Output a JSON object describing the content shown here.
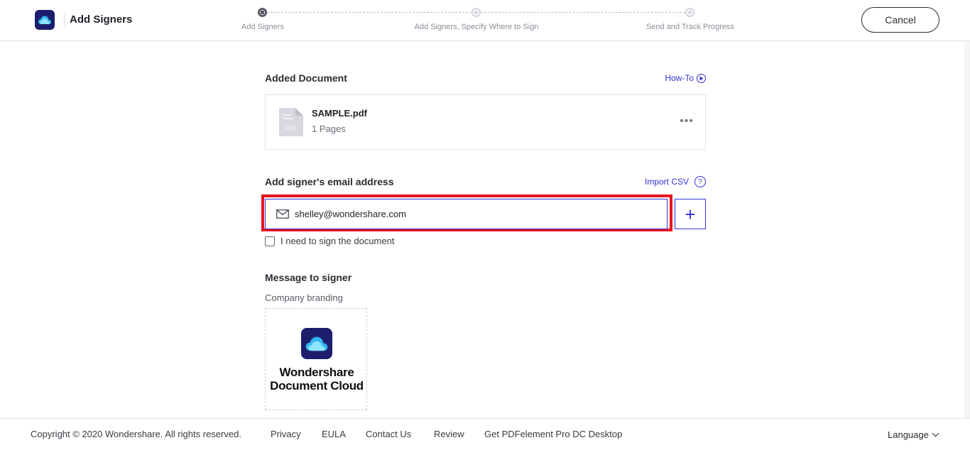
{
  "header": {
    "title": "Add Signers",
    "cancel_label": "Cancel",
    "steps": [
      {
        "label": "Add Signers",
        "state": "active"
      },
      {
        "label": "Add Signers, Specify Where to Sign",
        "state": "inactive"
      },
      {
        "label": "Send and Track Progress",
        "state": "inactive"
      }
    ]
  },
  "document": {
    "section_title": "Added Document",
    "howto_label": "How-To",
    "file_name": "SAMPLE.pdf",
    "pages": "1 Pages",
    "file_type": "PDF",
    "more_label": "•••"
  },
  "signers": {
    "section_title": "Add signer's email address",
    "import_label": "Import CSV",
    "help_glyph": "?",
    "email_value": "shelley@wondershare.com",
    "add_glyph": "+",
    "self_sign_label": "I need to sign the document"
  },
  "message": {
    "section_title": "Message to signer",
    "branding_label": "Company branding",
    "brand_line1": "Wondershare",
    "brand_line2": "Document Cloud"
  },
  "footer": {
    "copyright": "Copyright © 2020 Wondershare. All rights reserved.",
    "links": [
      "Privacy",
      "EULA",
      "Contact Us",
      "Review",
      "Get PDFelement Pro DC Desktop"
    ],
    "language_label": "Language"
  },
  "colors": {
    "accent": "#3230d6",
    "highlight": "#e8141e",
    "brand_dark": "#1d1e6b"
  },
  "icons": {
    "app_logo": "cloud-icon",
    "howto": "play-circle-icon",
    "email": "mail-icon",
    "file": "pdf-file-icon"
  }
}
